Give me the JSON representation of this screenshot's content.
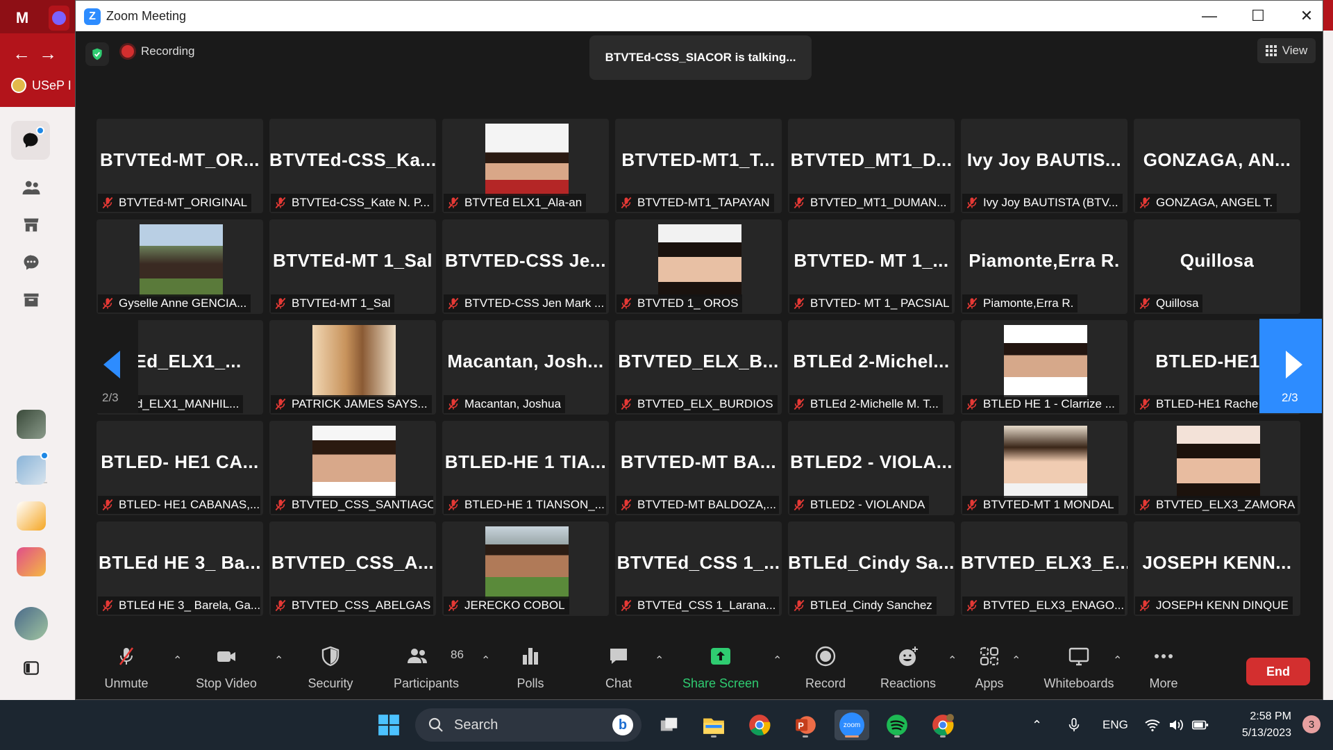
{
  "browser_bg": {
    "bookmark_label": "USeP I",
    "tabs": [
      "M"
    ]
  },
  "window": {
    "title": "Zoom Meeting",
    "minimize": "—",
    "maximize": "☐",
    "close": "✕"
  },
  "meeting": {
    "recording_label": "Recording",
    "talking_text": "BTVTEd-CSS_SIACOR is talking...",
    "view_label": "View",
    "page_indicator": "2/3"
  },
  "tiles": [
    {
      "name": "BTVTEd-MT_OR...",
      "label": "BTVTEd-MT_ORIGINAL"
    },
    {
      "name": "BTVTEd-CSS_Ka...",
      "label": "BTVTEd-CSS_Kate N. P..."
    },
    {
      "name": "",
      "label": "BTVTEd ELX1_Ala-an",
      "photo": "portrait-1"
    },
    {
      "name": "BTVTED-MT1_T...",
      "label": "BTVTED-MT1_TAPAYAN"
    },
    {
      "name": "BTVTED_MT1_D...",
      "label": "BTVTED_MT1_DUMAN..."
    },
    {
      "name": "Ivy Joy BAUTIS...",
      "label": "Ivy Joy BAUTISTA (BTV..."
    },
    {
      "name": "GONZAGA, AN...",
      "label": "GONZAGA, ANGEL T."
    },
    {
      "name": "",
      "label": "Gyselle Anne GENCIA...",
      "photo": "outdoor-1"
    },
    {
      "name": "BTVTEd-MT 1_Sal",
      "label": "BTVTEd-MT 1_Sal"
    },
    {
      "name": "BTVTED-CSS Je...",
      "label": "BTVTED-CSS Jen Mark ..."
    },
    {
      "name": "",
      "label": "BTVTED 1_ OROS",
      "photo": "portrait-2"
    },
    {
      "name": "BTVTED- MT 1_...",
      "label": "BTVTED- MT 1_ PACSIAL"
    },
    {
      "name": "Piamonte,Erra R.",
      "label": "Piamonte,Erra R."
    },
    {
      "name": "Quillosa",
      "label": "Quillosa"
    },
    {
      "name": "'TEd_ELX1_...",
      "label": "'TEd_ELX1_MANHIL..."
    },
    {
      "name": "",
      "label": "PATRICK JAMES SAYS...",
      "photo": "warm-1"
    },
    {
      "name": "Macantan, Josh...",
      "label": "Macantan, Joshua"
    },
    {
      "name": "BTVTED_ELX_B...",
      "label": "BTVTED_ELX_BURDIOS"
    },
    {
      "name": "BTLEd 2-Michel...",
      "label": "BTLEd 2-Michelle M. T..."
    },
    {
      "name": "",
      "label": "BTLED HE 1 - Clarrize ...",
      "photo": "portrait-3"
    },
    {
      "name": "BTLED-HE1 R",
      "label": "BTLED-HE1 Rache"
    },
    {
      "name": "BTLED- HE1 CA...",
      "label": "BTLED- HE1 CABANAS,..."
    },
    {
      "name": "",
      "label": "BTVTED_CSS_SANTIAGO",
      "photo": "portrait-4"
    },
    {
      "name": "BTLED-HE 1 TIA...",
      "label": "BTLED-HE 1 TIANSON_..."
    },
    {
      "name": "BTVTED-MT BA...",
      "label": "BTVTED-MT BALDOZA,..."
    },
    {
      "name": "BTLED2 - VIOLA...",
      "label": "BTLED2 - VIOLANDA"
    },
    {
      "name": "",
      "label": "BTVTED-MT 1 MONDAL",
      "photo": "portrait-5"
    },
    {
      "name": "",
      "label": "BTVTED_ELX3_ZAMORA",
      "photo": "portrait-6"
    },
    {
      "name": "BTLEd HE 3_ Ba...",
      "label": "BTLEd HE 3_ Barela, Ga..."
    },
    {
      "name": "BTVTED_CSS_A...",
      "label": "BTVTED_CSS_ABELGAS"
    },
    {
      "name": "",
      "label": "JERECKO COBOL",
      "photo": "outdoor-2"
    },
    {
      "name": "BTVTEd_CSS 1_...",
      "label": "BTVTEd_CSS 1_Larana..."
    },
    {
      "name": "BTLEd_Cindy Sa...",
      "label": "BTLEd_Cindy Sanchez"
    },
    {
      "name": "BTVTED_ELX3_E...",
      "label": "BTVTED_ELX3_ENAGO..."
    },
    {
      "name": "JOSEPH KENN...",
      "label": "JOSEPH KENN DINQUE"
    }
  ],
  "toolbar": {
    "unmute": "Unmute",
    "stop_video": "Stop Video",
    "security": "Security",
    "participants": "Participants",
    "participants_count": "86",
    "polls": "Polls",
    "chat": "Chat",
    "share_screen": "Share Screen",
    "record": "Record",
    "reactions": "Reactions",
    "apps": "Apps",
    "whiteboards": "Whiteboards",
    "more": "More",
    "end": "End"
  },
  "taskbar": {
    "search_label": "Search",
    "language": "ENG",
    "time": "2:58 PM",
    "date": "5/13/2023",
    "notifications": "3",
    "zoom_label": "zoom"
  },
  "colors": {
    "accent": "#2d8cff",
    "end": "#d32f2f",
    "share": "#2fcc71",
    "browser": "#b3141b"
  }
}
